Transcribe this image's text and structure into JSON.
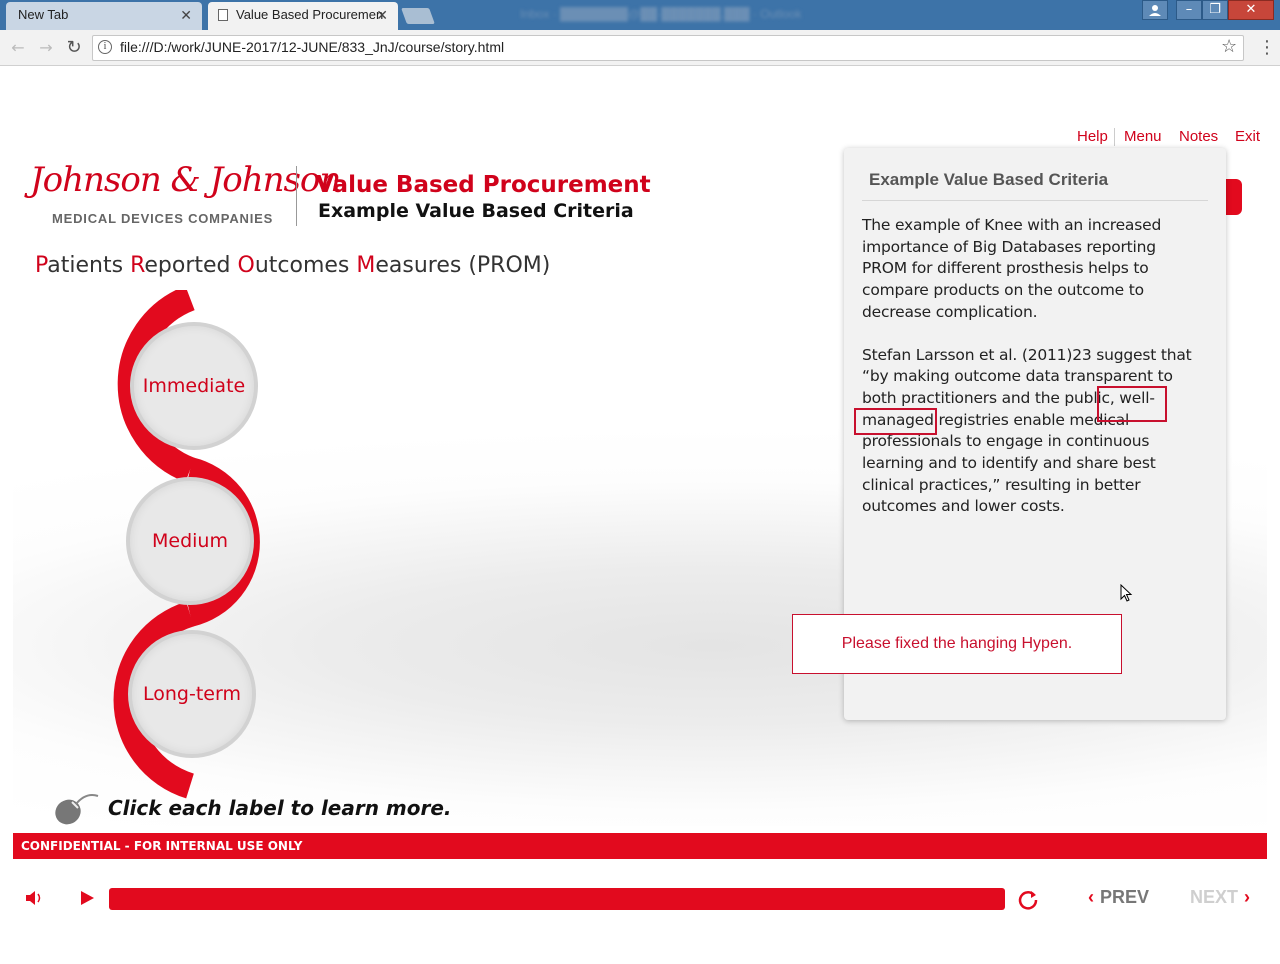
{
  "browser": {
    "tabs": [
      {
        "label": "New Tab",
        "active": false
      },
      {
        "label": "Value Based Procuremen",
        "active": true
      }
    ],
    "url": "file:///D:/work/JUNE-2017/12-JUNE/833_JnJ/course/story.html",
    "close_glyph": "✕",
    "minimize_glyph": "–",
    "maximize_glyph": "❐",
    "window_close_glyph": "✕",
    "back_glyph": "←",
    "forward_glyph": "→",
    "reload_glyph": "↻",
    "star_glyph": "☆",
    "kebab_glyph": "⋮",
    "info_glyph": "i"
  },
  "course": {
    "nav": {
      "help": "Help",
      "menu": "Menu",
      "notes": "Notes",
      "exit": "Exit"
    },
    "logo_text": "Johnson & Johnson",
    "logo_sub": "MEDICAL DEVICES COMPANIES",
    "title": "Value Based Procurement",
    "subtitle": "Example Value Based Criteria",
    "prom": {
      "p": "P",
      "p_rest": "atients ",
      "r": "R",
      "r_rest": "eported ",
      "o": "O",
      "o_rest": "utcomes ",
      "m": "M",
      "m_rest": "easures (PROM)"
    },
    "labels": [
      "Immediate",
      "Medium",
      "Long-term"
    ],
    "instruction": "Click each label to learn more.",
    "confidential": "CONFIDENTIAL - FOR INTERNAL USE ONLY",
    "controls": {
      "prev": "PREV",
      "next": "NEXT",
      "prev_glyph": "‹",
      "next_glyph": "›"
    },
    "accent_color": "#e20a1e"
  },
  "notes": {
    "title": "Example Value Based Criteria",
    "paragraph1": "The example of Knee with an increased importance of Big Databases reporting PROM for different prosthesis helps to compare products on the outcome to decrease complication.",
    "paragraph2": "Stefan Larsson et al. (2011)23 suggest that “by making outcome data transparent to both practitioners and the public, well-managed registries enable medical professionals to engage in continuous learning and to identify and share best clinical practices,” resulting in better outcomes and lower costs."
  },
  "review_comment": "Please fixed the hanging Hypen."
}
